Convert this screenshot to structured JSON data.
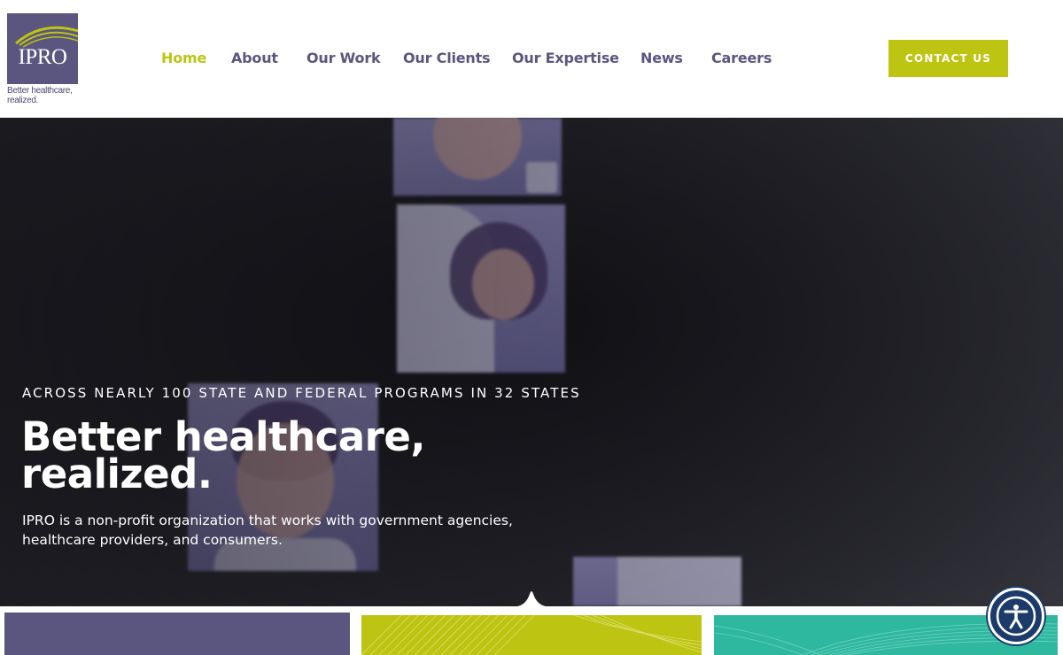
{
  "brand": {
    "logo_text": "IPRO",
    "tagline": "Better healthcare, realized.",
    "colors": {
      "purple": "#5b5680",
      "lime": "#bdc411",
      "teal": "#2fb8a0",
      "navy": "#1c3b6b"
    }
  },
  "nav": {
    "items": [
      {
        "label": "Home",
        "active": true
      },
      {
        "label": "About",
        "active": false
      },
      {
        "label": "Our Work",
        "active": false
      },
      {
        "label": "Our Clients",
        "active": false
      },
      {
        "label": "Our Expertise",
        "active": false
      },
      {
        "label": "News",
        "active": false
      },
      {
        "label": "Careers",
        "active": false
      }
    ],
    "contact_label": "CONTACT US"
  },
  "hero": {
    "eyebrow": "ACROSS NEARLY 100 STATE AND FEDERAL PROGRAMS IN 32 STATES",
    "headline_line1": "Better healthcare,",
    "headline_line2": "realized.",
    "intro": "IPRO is a non-profit organization that works with government agencies, healthcare providers, and consumers."
  },
  "icons": {
    "accessibility": "accessibility-icon"
  }
}
